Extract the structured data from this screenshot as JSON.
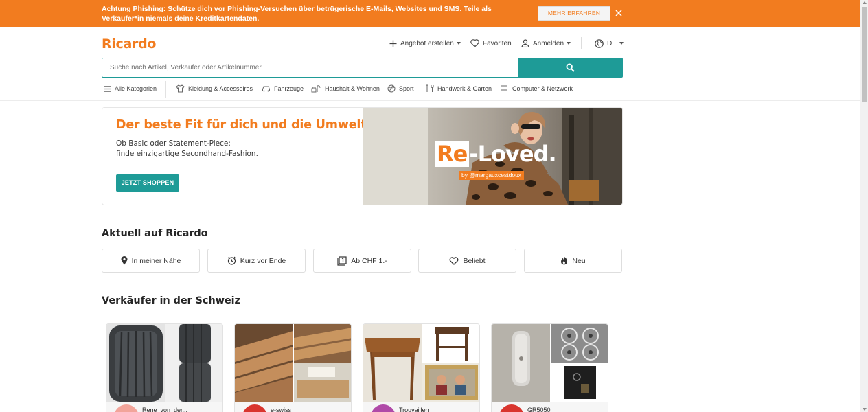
{
  "warning": {
    "text": "Achtung Phishing: Schütze dich vor Phishing-Versuchen über betrügerische E-Mails, Websites und SMS. Teile als Verkäufer*in niemals deine Kreditkartendaten.",
    "more_label": "MEHR ERFAHREN",
    "close_icon": "close-icon"
  },
  "header": {
    "logo": "Ricardo",
    "create_listing": "Angebot erstellen",
    "favorites": "Favoriten",
    "login": "Anmelden",
    "language": "DE"
  },
  "search": {
    "placeholder": "Suche nach Artikel, Verkäufer oder Artikelnummer",
    "value": ""
  },
  "categories": [
    {
      "label": "Alle Kategorien",
      "icon": "menu-icon"
    },
    {
      "label": "Kleidung & Accessoires",
      "icon": "shirt-icon"
    },
    {
      "label": "Fahrzeuge",
      "icon": "car-icon"
    },
    {
      "label": "Haushalt & Wohnen",
      "icon": "household-icon"
    },
    {
      "label": "Sport",
      "icon": "ball-icon"
    },
    {
      "label": "Handwerk & Garten",
      "icon": "tools-icon"
    },
    {
      "label": "Computer & Netzwerk",
      "icon": "laptop-icon"
    }
  ],
  "hero": {
    "title": "Der beste Fit für dich und die Umwelt",
    "subtitle_line1": "Ob Basic oder Statement-Piece:",
    "subtitle_line2": "finde einzigartige Secondhand-Fashion.",
    "cta": "JETZT SHOPPEN",
    "brand_re": "Re",
    "brand_rest": "-Loved.",
    "credit": "by @margauxcestdoux"
  },
  "aktuell": {
    "title": "Aktuell auf Ricardo",
    "buttons": [
      {
        "label": "In meiner Nähe",
        "icon": "location-pin-icon"
      },
      {
        "label": "Kurz vor Ende",
        "icon": "alarm-clock-icon"
      },
      {
        "label": "Ab CHF 1.-",
        "icon": "one-franc-icon"
      },
      {
        "label": "Beliebt",
        "icon": "heart-icon"
      },
      {
        "label": "Neu",
        "icon": "flame-icon"
      }
    ]
  },
  "sellers": {
    "title": "Verkäufer in der Schweiz",
    "items": [
      {
        "name": "Rene_von_der...",
        "avatar_color": "#f2a49a",
        "images": [
          "tyre",
          "tyre",
          "tyre"
        ]
      },
      {
        "name": "e-swiss",
        "avatar_color": "#d9352e",
        "images": [
          "wood-planks",
          "wood-planks",
          "wood-planks"
        ]
      },
      {
        "name": "Trouvaillen",
        "avatar_color": "#b04aa8",
        "images": [
          "wooden-table",
          "wooden-stool",
          "framed-painting"
        ]
      },
      {
        "name": "GR5050",
        "avatar_color": "#d9352e",
        "images": [
          "metal-part",
          "wheel-rims",
          "small-parts"
        ]
      }
    ]
  },
  "colors": {
    "brand_orange": "#f27c1f",
    "teal": "#1e9b97"
  }
}
